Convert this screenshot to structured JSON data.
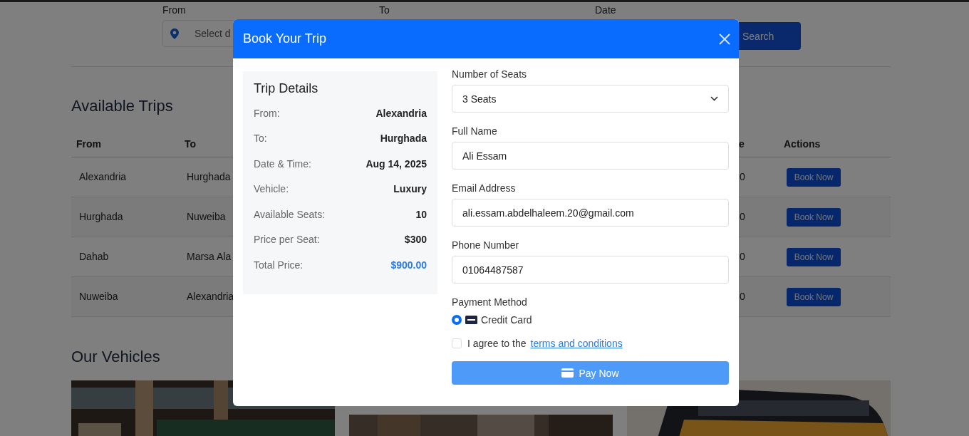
{
  "search_form": {
    "fields": [
      {
        "label": "From",
        "placeholder": "Select d"
      },
      {
        "label": "To"
      },
      {
        "label": "Date"
      }
    ],
    "search_button": "Search"
  },
  "available_trips": {
    "title": "Available Trips",
    "columns": [
      "From",
      "To",
      "e",
      "Actions"
    ],
    "rows": [
      {
        "from": "Alexandria",
        "to": "Hurghada",
        "column_3": "0",
        "action": "Book Now"
      },
      {
        "from": "Hurghada",
        "to": "Nuweiba",
        "column_3": "0",
        "action": "Book Now"
      },
      {
        "from": "Dahab",
        "to": "Marsa Ala",
        "column_3": "0",
        "action": "Book Now"
      },
      {
        "from": "Nuweiba",
        "to": "Alexandria",
        "column_3": "0",
        "action": "Book Now"
      }
    ]
  },
  "vehicles": {
    "title": "Our Vehicles"
  },
  "modal": {
    "title": "Book Your Trip",
    "trip_details": {
      "title": "Trip Details",
      "rows": [
        {
          "label": "From:",
          "value": "Alexandria",
          "kind": "plain"
        },
        {
          "label": "To:",
          "value": "Hurghada",
          "kind": "plain"
        },
        {
          "label": "Date & Time:",
          "value": "Aug 14, 2025",
          "kind": "plain"
        },
        {
          "label": "Vehicle:",
          "value": "Luxury",
          "kind": "plain"
        },
        {
          "label": "Available Seats:",
          "value": "10",
          "kind": "plain"
        },
        {
          "label": "Price per Seat:",
          "value": "$300",
          "kind": "plain"
        },
        {
          "label": "Total Price:",
          "value": "$900.00",
          "kind": "total"
        }
      ]
    },
    "form": {
      "seats": {
        "label": "Number of Seats",
        "value": "3 Seats"
      },
      "fields": [
        {
          "label": "Full Name",
          "value": "Ali Essam"
        },
        {
          "label": "Email Address",
          "value": "ali.essam.abdelhaleem.20@gmail.com"
        },
        {
          "label": "Phone Number",
          "value": "01064487587"
        }
      ],
      "payment": {
        "label": "Payment Method",
        "options": [
          {
            "label": "Credit Card",
            "selected": true
          }
        ]
      },
      "terms": {
        "text": "I agree to the",
        "link": "terms and conditions",
        "checked": false
      },
      "pay_button": "Pay Now"
    }
  }
}
